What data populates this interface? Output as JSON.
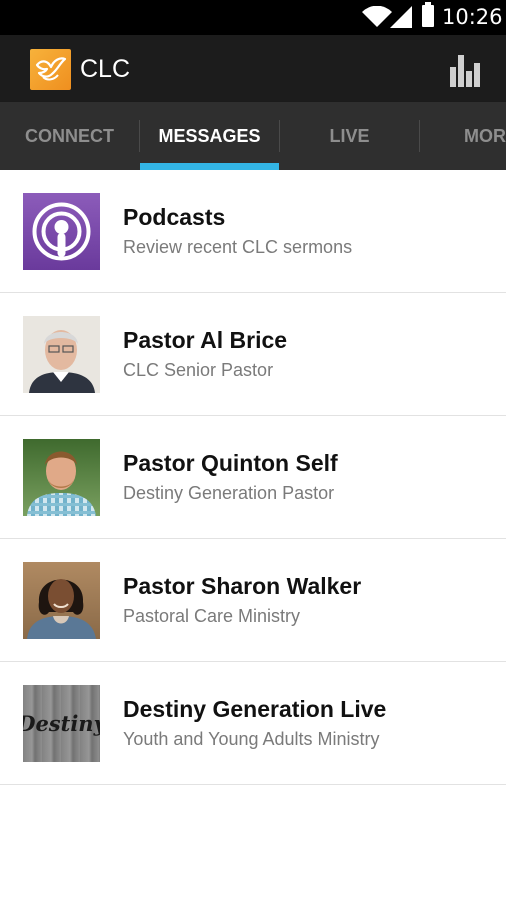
{
  "status_bar": {
    "time": "10:26",
    "icons": [
      "wifi-icon",
      "signal-icon",
      "battery-icon"
    ]
  },
  "app_bar": {
    "title": "CLC",
    "logo_icon": "dove-logo-icon",
    "action_icon": "bar-chart-icon",
    "brand_color": "#f0a030"
  },
  "tabs": [
    {
      "label": "CONNECT",
      "active": false
    },
    {
      "label": "MESSAGES",
      "active": true
    },
    {
      "label": "LIVE",
      "active": false
    },
    {
      "label": "MOR",
      "active": false
    }
  ],
  "accent_color": "#33b5e5",
  "items": [
    {
      "title": "Podcasts",
      "subtitle": "Review recent CLC sermons",
      "thumb": "podcast-icon"
    },
    {
      "title": "Pastor Al Brice",
      "subtitle": "CLC Senior Pastor",
      "thumb": "avatar"
    },
    {
      "title": "Pastor Quinton Self",
      "subtitle": "Destiny Generation Pastor",
      "thumb": "avatar"
    },
    {
      "title": "Pastor Sharon Walker",
      "subtitle": "Pastoral Care Ministry",
      "thumb": "avatar"
    },
    {
      "title": "Destiny Generation Live",
      "subtitle": "Youth and Young Adults Ministry",
      "thumb": "logo"
    }
  ],
  "destiny_thumb_text": "Destiny"
}
